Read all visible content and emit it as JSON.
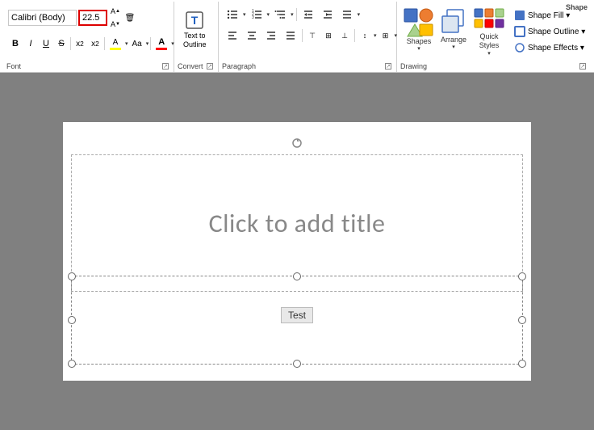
{
  "ribbon": {
    "groups": {
      "font": {
        "label": "Font",
        "font_name": "Calibri (Body)",
        "font_size": "22.5",
        "bold": "B",
        "italic": "I",
        "underline": "U",
        "strikethrough": "S",
        "sub": "X₂",
        "sup": "X²",
        "increase_font": "A",
        "decrease_font": "A",
        "clear_format": "🗑",
        "font_color_label": "A",
        "highlight_label": "A",
        "change_case": "Aa"
      },
      "convert": {
        "label": "Convert",
        "text_to_outline": "Text to\nOutline",
        "text_to_outline_icon": "T"
      },
      "paragraph": {
        "label": "Paragraph",
        "bullets": "☰",
        "numbering": "☰",
        "multi_level": "☰",
        "decrease_indent": "⬅",
        "increase_indent": "➡",
        "spacing": "↕",
        "align_left": "≡",
        "align_center": "≡",
        "align_right": "≡",
        "justify": "≡",
        "align_top": "⊤",
        "align_middle": "⊞",
        "align_bottom": "⊥",
        "direction": "↕",
        "columns": "⊞"
      },
      "drawing": {
        "label": "Drawing",
        "shapes_label": "Shapes",
        "arrange_label": "Arrange",
        "quick_styles_label": "Quick\nStyles",
        "shape_fill": "Shape Fill ▾",
        "shape_outline": "Shape Outline ▾",
        "shape_effects": "Shape Effects ▾",
        "shape_label": "Shape"
      }
    }
  },
  "slide": {
    "title_placeholder": "Click to add title",
    "text_label": "Test"
  }
}
